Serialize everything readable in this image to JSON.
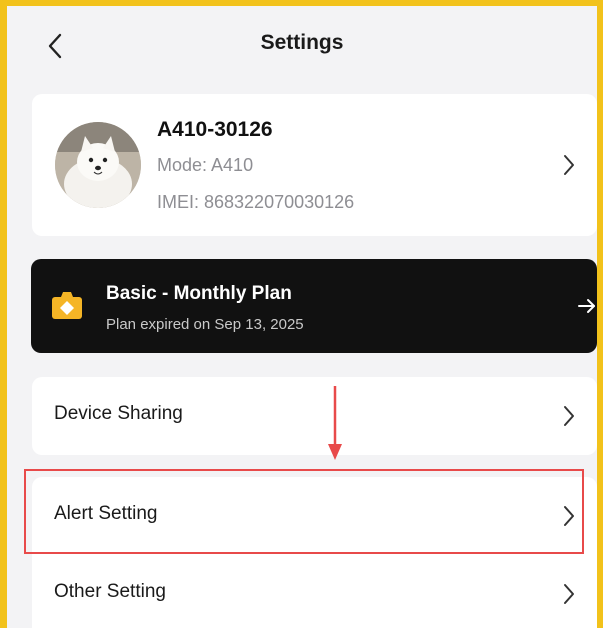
{
  "header": {
    "title": "Settings",
    "back_icon": "chevron-left-icon"
  },
  "device": {
    "name": "A410-30126",
    "mode": "Mode: A410",
    "imei": "IMEI: 868322070030126",
    "avatar": "samoyed-dog-photo"
  },
  "plan": {
    "title": "Basic - Monthly Plan",
    "subtitle": "Plan expired on Sep 13, 2025",
    "icon": "camera-badge-icon",
    "arrow_icon": "arrow-right-icon"
  },
  "menu": [
    {
      "label": "Device Sharing"
    },
    {
      "label": "Alert Setting"
    },
    {
      "label": "Other Setting"
    }
  ],
  "colors": {
    "frame": "#f2c21b",
    "background": "#f3f3f5",
    "plan_bg": "#111111",
    "plan_icon": "#f5b526",
    "annotation": "#e84a4a"
  }
}
